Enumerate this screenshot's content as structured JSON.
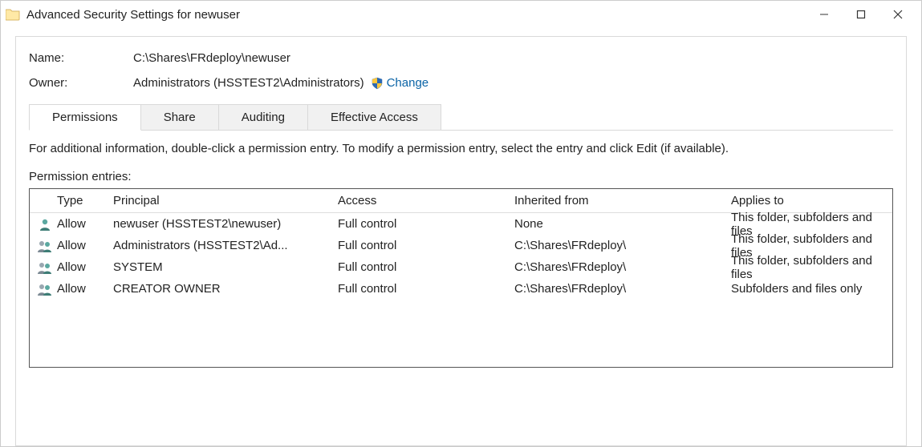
{
  "window": {
    "title": "Advanced Security Settings for newuser"
  },
  "fields": {
    "name_label": "Name:",
    "name_value": "C:\\Shares\\FRdeploy\\newuser",
    "owner_label": "Owner:",
    "owner_value": "Administrators (HSSTEST2\\Administrators)",
    "change_label": "Change"
  },
  "tabs": {
    "permissions": "Permissions",
    "share": "Share",
    "auditing": "Auditing",
    "effective_access": "Effective Access"
  },
  "info_text": "For additional information, double-click a permission entry. To modify a permission entry, select the entry and click Edit (if available).",
  "entries_label": "Permission entries:",
  "columns": {
    "type": "Type",
    "principal": "Principal",
    "access": "Access",
    "inherited": "Inherited from",
    "applies": "Applies to"
  },
  "rows": [
    {
      "icon": "single",
      "type": "Allow",
      "principal": "newuser (HSSTEST2\\newuser)",
      "access": "Full control",
      "inherited": "None",
      "applies": "This folder, subfolders and files"
    },
    {
      "icon": "group",
      "type": "Allow",
      "principal": "Administrators (HSSTEST2\\Ad...",
      "access": "Full control",
      "inherited": "C:\\Shares\\FRdeploy\\",
      "applies": "This folder, subfolders and files"
    },
    {
      "icon": "group",
      "type": "Allow",
      "principal": "SYSTEM",
      "access": "Full control",
      "inherited": "C:\\Shares\\FRdeploy\\",
      "applies": "This folder, subfolders and files"
    },
    {
      "icon": "group",
      "type": "Allow",
      "principal": "CREATOR OWNER",
      "access": "Full control",
      "inherited": "C:\\Shares\\FRdeploy\\",
      "applies": "Subfolders and files only"
    }
  ]
}
